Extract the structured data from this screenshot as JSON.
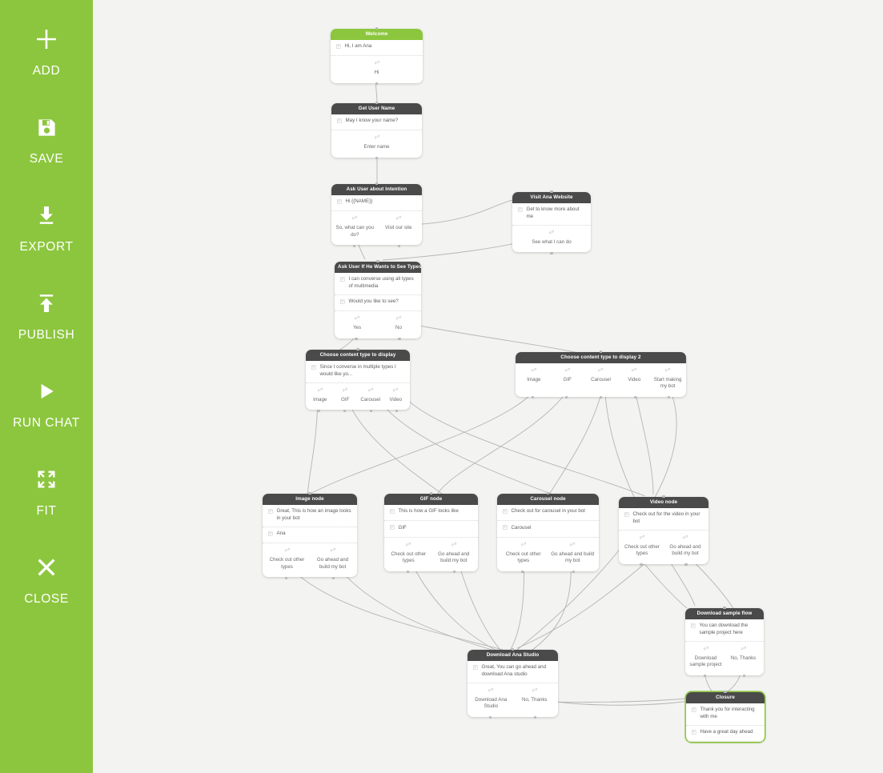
{
  "sidebar": {
    "items": [
      {
        "label": "ADD",
        "icon": "plus-icon"
      },
      {
        "label": "SAVE",
        "icon": "floppy-disk-icon"
      },
      {
        "label": "EXPORT",
        "icon": "download-arrow-icon"
      },
      {
        "label": "PUBLISH",
        "icon": "upload-arrow-icon"
      },
      {
        "label": "RUN CHAT",
        "icon": "play-icon"
      },
      {
        "label": "FIT",
        "icon": "expand-arrows-icon"
      },
      {
        "label": "CLOSE",
        "icon": "close-x-icon"
      }
    ],
    "background_color": "#8cc63e",
    "text_color": "#ffffff"
  },
  "canvas": {
    "background_color": "#f3f3f1",
    "node_header_color": "#4a4a4a",
    "node_header_start_color": "#8cc63e",
    "selected_border_color": "#8cc63e"
  },
  "nodes": [
    {
      "id": "welcome",
      "title": "Welcome",
      "header_style": "green",
      "messages": [
        "Hi, I am Ana"
      ],
      "buttons": [
        "Hi"
      ]
    },
    {
      "id": "get-user-name",
      "title": "Get User Name",
      "header_style": "dark",
      "messages": [
        "May I know your name?"
      ],
      "buttons": [
        "Enter name"
      ]
    },
    {
      "id": "ask-user-about-intention",
      "title": "Ask User about Intention",
      "header_style": "dark",
      "messages": [
        "Hi {{NAME}}"
      ],
      "buttons": [
        "So, what can you do?",
        "Visit our site"
      ]
    },
    {
      "id": "visit-ana-website",
      "title": "Visit Ana Website",
      "header_style": "dark",
      "messages": [
        "Get to know more about me"
      ],
      "buttons": [
        "See what I can do"
      ]
    },
    {
      "id": "ask-user-types",
      "title": "Ask User If He Wants to See Types of",
      "header_style": "dark",
      "messages": [
        "I can converse using all types of multimedia",
        "Would you like to see?"
      ],
      "buttons": [
        "Yes",
        "No"
      ]
    },
    {
      "id": "choose-content-type",
      "title": "Choose content type to display",
      "header_style": "dark",
      "messages": [
        "Since I converse in multiple types I would like yo..."
      ],
      "buttons": [
        "Image",
        "GIF",
        "Carousel",
        "Video"
      ]
    },
    {
      "id": "choose-content-type-2",
      "title": "Choose content type to display 2",
      "header_style": "dark",
      "messages": [],
      "buttons": [
        "Image",
        "GIF",
        "Carousel",
        "Video",
        "Start making my bot"
      ]
    },
    {
      "id": "image-node",
      "title": "Image node",
      "header_style": "dark",
      "messages": [
        "Great, This is how an image looks in your bot",
        "Ana"
      ],
      "buttons": [
        "Check out other types",
        "Go ahead and build my bot"
      ]
    },
    {
      "id": "gif-node",
      "title": "GIF node",
      "header_style": "dark",
      "messages": [
        "This is how a GIF looks like",
        "GIF"
      ],
      "buttons": [
        "Check out other types",
        "Go ahead and build my bot"
      ]
    },
    {
      "id": "carousel-node",
      "title": "Carousel node",
      "header_style": "dark",
      "messages": [
        "Check out for carousel in your bot",
        "Carousel"
      ],
      "buttons": [
        "Check out other types",
        "Go ahead and build my bot"
      ]
    },
    {
      "id": "video-node",
      "title": "Video node",
      "header_style": "dark",
      "messages": [
        "Check out for the video in your bot"
      ],
      "buttons": [
        "Check out other types",
        "Go ahead and build my bot"
      ]
    },
    {
      "id": "download-ana-studio",
      "title": "Download Ana Studio",
      "header_style": "dark",
      "messages": [
        "Great, You can go ahead and download Ana studio"
      ],
      "buttons": [
        "Download Ana Studio",
        "No, Thanks"
      ]
    },
    {
      "id": "download-sample-flow",
      "title": "Download sample flow",
      "header_style": "dark",
      "messages": [
        "You can download the sample project here"
      ],
      "buttons": [
        "Download sample project",
        "No, Thanks"
      ]
    },
    {
      "id": "closure",
      "title": "Closure",
      "header_style": "dark",
      "selected": true,
      "messages": [
        "Thank you for interacting with me",
        "Have a great day ahead"
      ],
      "buttons": []
    }
  ]
}
